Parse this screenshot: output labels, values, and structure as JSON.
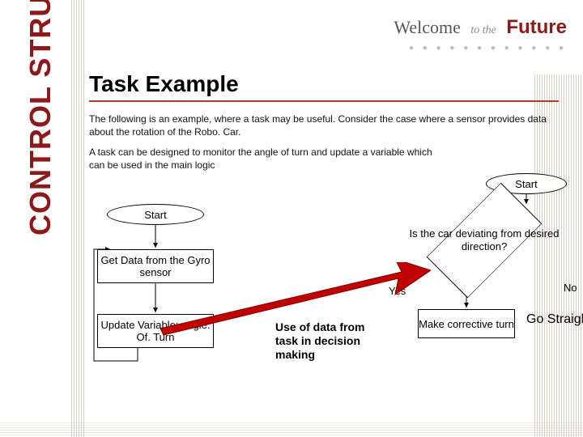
{
  "sidebar_label": "CONTROL STRUCTURES",
  "header": {
    "welcome": "Welcome",
    "to_the": "to the",
    "future": "Future",
    "dots": "● ● ● ● ● ●  ● ● ● ● ● ●"
  },
  "title": "Task Example",
  "para1": "The following is an example, where a task may be useful. Consider the case where a sensor provides data about the rotation of the Robo. Car.",
  "para2": "A task can be designed to monitor the angle of turn and update a variable which can be used in the main logic",
  "diagram": {
    "start_left": "Start",
    "get_data": "Get Data from the Gyro sensor",
    "update_var": "Update Variable: angle. Of. Turn",
    "start_right": "Start",
    "decision": "Is the car deviating  from desired direction?",
    "yes": "Yes",
    "no": "No",
    "make_turn": "Make corrective turn",
    "go_straight": "Go Straight",
    "callout": "Use of data from task in decision making"
  }
}
